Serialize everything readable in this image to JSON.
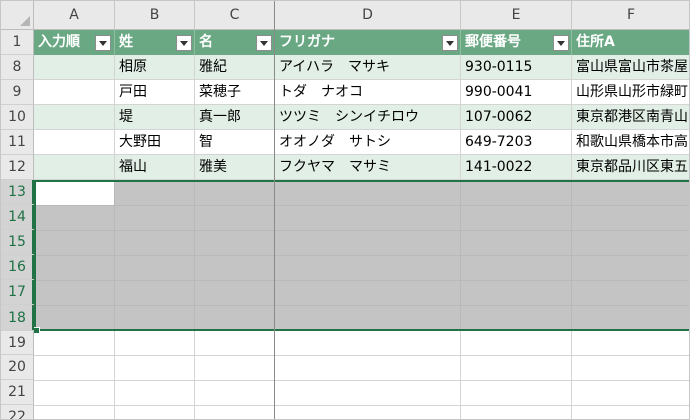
{
  "columns": [
    "A",
    "B",
    "C",
    "D",
    "E",
    "F"
  ],
  "header_row": "1",
  "table_headers": [
    "入力順",
    "姓",
    "名",
    "フリガナ",
    "郵便番号",
    "住所A"
  ],
  "rows": [
    {
      "num": "8",
      "cells": [
        "",
        "相原",
        "雅紀",
        "アイハラ　マサキ",
        "930-0115",
        "富山県富山市茶屋"
      ]
    },
    {
      "num": "9",
      "cells": [
        "",
        "戸田",
        "菜穂子",
        "トダ　ナオコ",
        "990-0041",
        "山形県山形市緑町"
      ]
    },
    {
      "num": "10",
      "cells": [
        "",
        "堤",
        "真一郎",
        "ツツミ　シンイチロウ",
        "107-0062",
        "東京都港区南青山"
      ]
    },
    {
      "num": "11",
      "cells": [
        "",
        "大野田",
        "智",
        "オオノダ　サトシ",
        "649-7203",
        "和歌山県橋本市高"
      ]
    },
    {
      "num": "12",
      "cells": [
        "",
        "福山",
        "雅美",
        "フクヤマ　マサミ",
        "141-0022",
        "東京都品川区東五"
      ]
    }
  ],
  "selected_rows": [
    "13",
    "14",
    "15",
    "16",
    "17",
    "18"
  ],
  "empty_rows": [
    "19",
    "20",
    "21",
    "22"
  ],
  "colors": {
    "table_header": "#6aa884",
    "band": "#e2efe6",
    "selection_border": "#217346",
    "selection_fill": "#c4c4c4"
  }
}
